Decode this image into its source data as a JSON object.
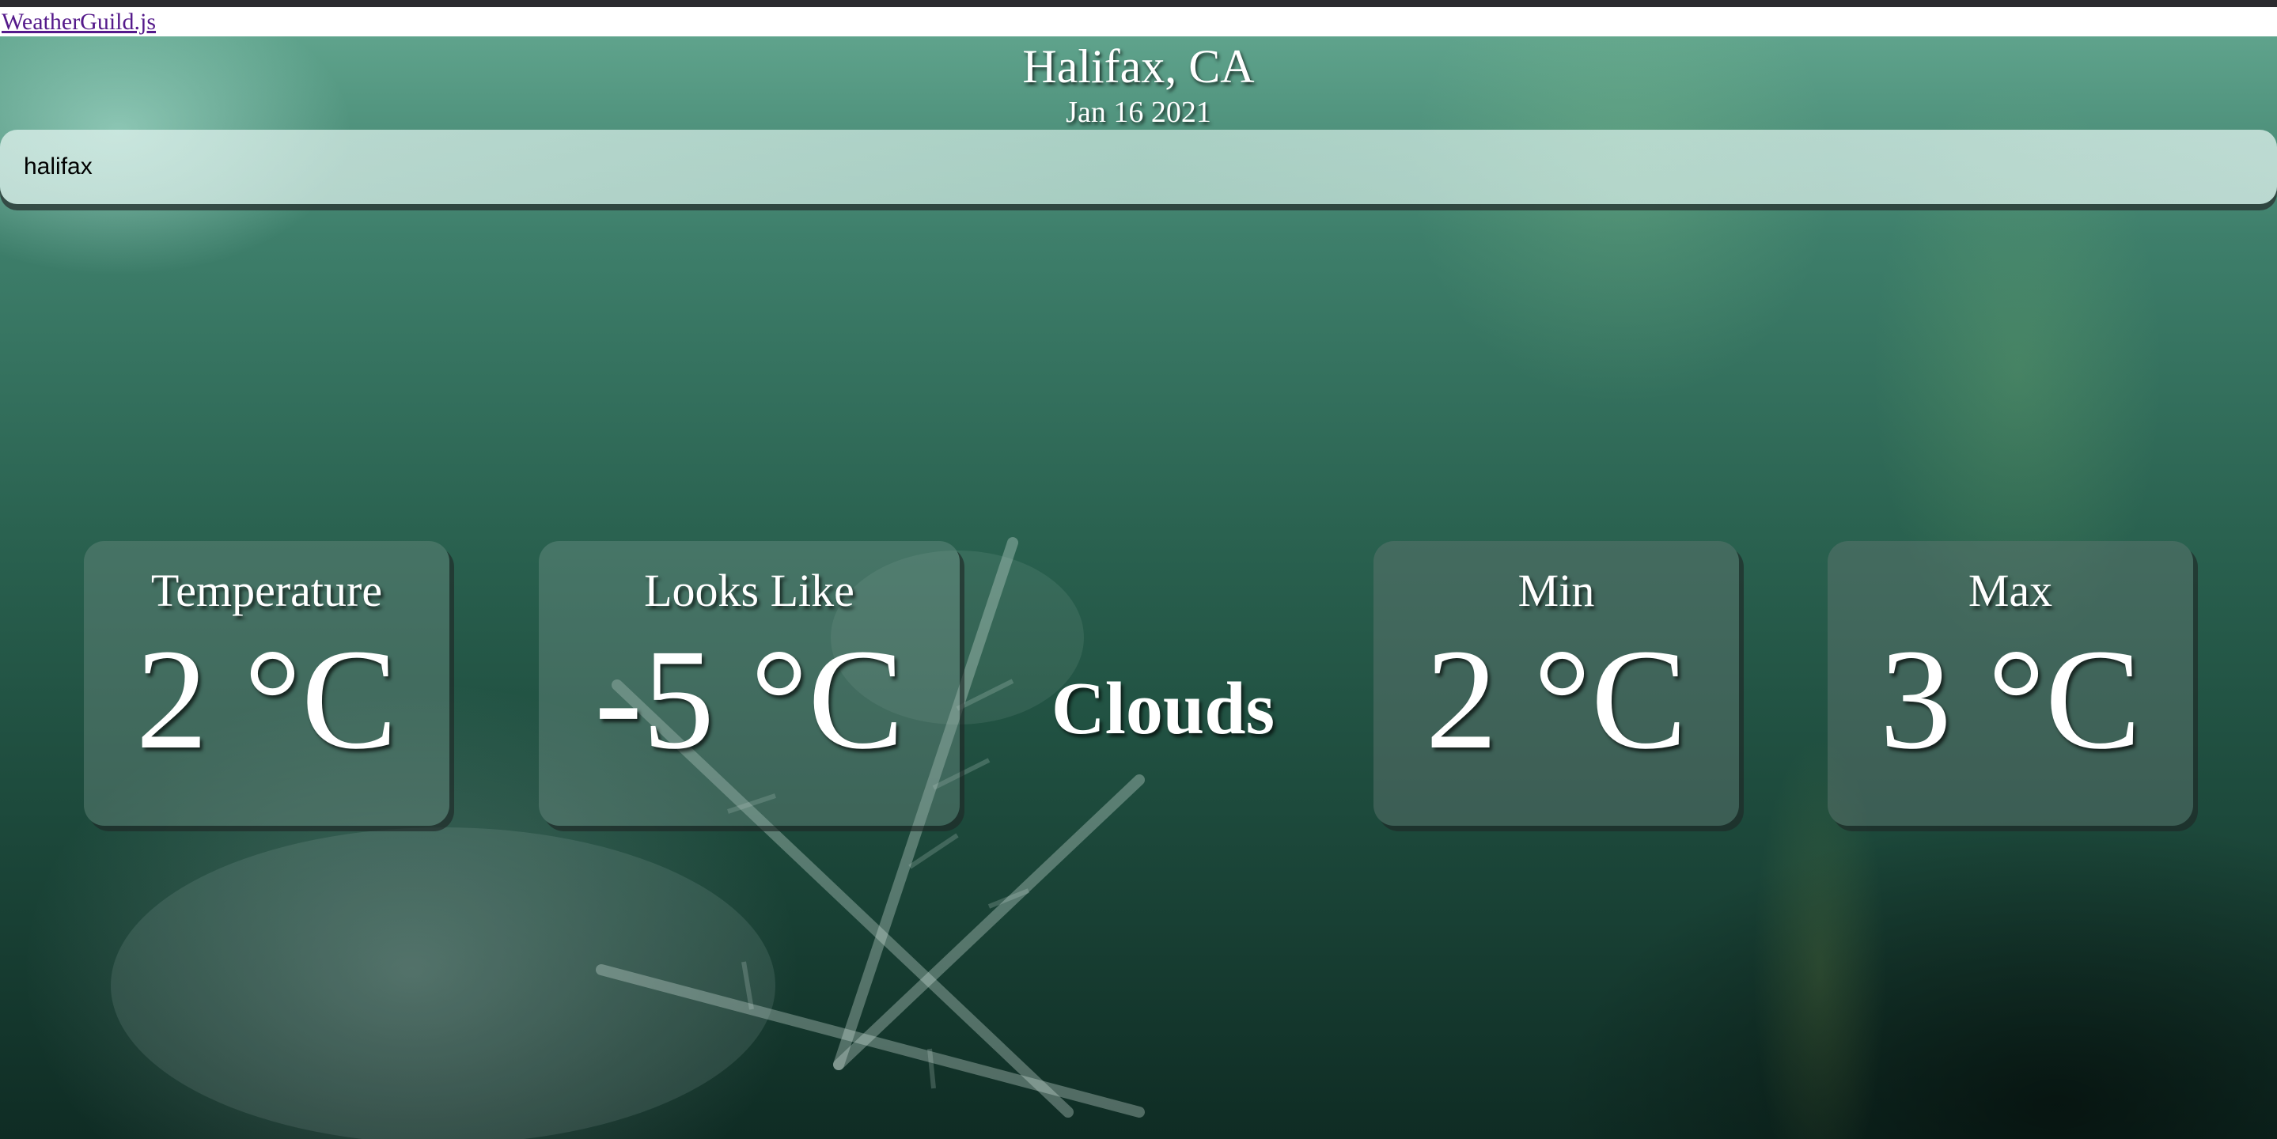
{
  "nav": {
    "brand": "WeatherGuild.js"
  },
  "location": {
    "city": "Halifax, CA",
    "date": "Jan 16 2021"
  },
  "search": {
    "value": "halifax"
  },
  "weather": {
    "temperature": {
      "label": "Temperature",
      "value": "2 °C"
    },
    "feels_like": {
      "label": "Looks Like",
      "value": "-5 °C"
    },
    "condition": "Clouds",
    "min": {
      "label": "Min",
      "value": "2 °C"
    },
    "max": {
      "label": "Max",
      "value": "3 °C"
    }
  },
  "colors": {
    "link": "#551a8b",
    "text": "#ffffff",
    "background_top": "#5fa38c",
    "background_bottom": "#0f2c24"
  }
}
